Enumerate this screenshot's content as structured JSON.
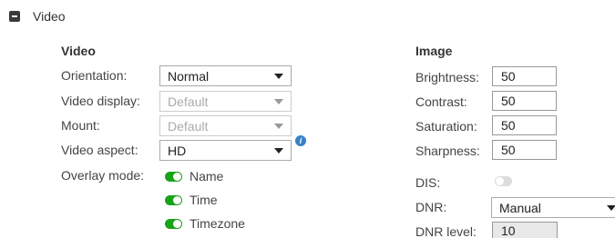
{
  "section": {
    "title": "Video"
  },
  "video": {
    "title": "Video",
    "orientation": {
      "label": "Orientation:",
      "value": "Normal"
    },
    "video_display": {
      "label": "Video display:",
      "value": "Default"
    },
    "mount": {
      "label": "Mount:",
      "value": "Default"
    },
    "video_aspect": {
      "label": "Video aspect:",
      "value": "HD"
    },
    "overlay_mode": {
      "label": "Overlay mode:",
      "options": [
        {
          "label": "Name",
          "enabled": true
        },
        {
          "label": "Time",
          "enabled": true
        },
        {
          "label": "Timezone",
          "enabled": true
        }
      ]
    }
  },
  "image": {
    "title": "Image",
    "brightness": {
      "label": "Brightness:",
      "value": "50"
    },
    "contrast": {
      "label": "Contrast:",
      "value": "50"
    },
    "saturation": {
      "label": "Saturation:",
      "value": "50"
    },
    "sharpness": {
      "label": "Sharpness:",
      "value": "50"
    },
    "dis": {
      "label": "DIS:",
      "enabled": false
    },
    "dnr": {
      "label": "DNR:",
      "value": "Manual"
    },
    "dnr_level": {
      "label": "DNR level:",
      "value": "10"
    }
  },
  "colors": {
    "toggle_on": "#19a319",
    "info": "#3a80c8"
  }
}
